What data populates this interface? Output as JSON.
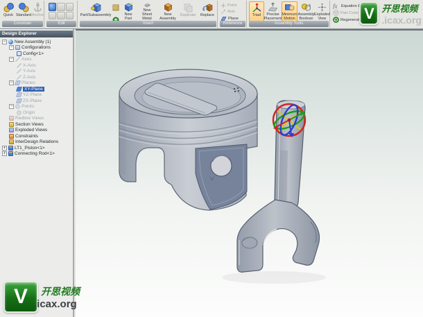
{
  "sidebar": {
    "title": "Design Explorer",
    "tree": [
      {
        "label": "New Assembly (1)",
        "level": 0,
        "state": "normal",
        "expanded": true
      },
      {
        "label": "Configurations",
        "level": 1,
        "state": "normal",
        "expanded": true
      },
      {
        "label": "Config<1>",
        "level": 2,
        "state": "normal"
      },
      {
        "label": "Axes",
        "level": 1,
        "state": "grayed",
        "expanded": true
      },
      {
        "label": "X-Axis",
        "level": 2,
        "state": "grayed"
      },
      {
        "label": "Y-Axis",
        "level": 2,
        "state": "grayed"
      },
      {
        "label": "Z-Axis",
        "level": 2,
        "state": "grayed"
      },
      {
        "label": "Planes",
        "level": 1,
        "state": "grayed",
        "expanded": true
      },
      {
        "label": "XY-Plane",
        "level": 2,
        "state": "selected"
      },
      {
        "label": "YZ-Plane",
        "level": 2,
        "state": "grayed"
      },
      {
        "label": "ZX-Plane",
        "level": 2,
        "state": "grayed"
      },
      {
        "label": "Points",
        "level": 1,
        "state": "grayed",
        "expanded": true
      },
      {
        "label": "Origin",
        "level": 2,
        "state": "grayed"
      },
      {
        "label": "Redline Views",
        "level": 1,
        "state": "grayed"
      },
      {
        "label": "Section Views",
        "level": 1,
        "state": "normal"
      },
      {
        "label": "Exploded Views",
        "level": 1,
        "state": "normal"
      },
      {
        "label": "Constraints",
        "level": 1,
        "state": "normal"
      },
      {
        "label": "InterDesign Relations",
        "level": 1,
        "state": "normal"
      },
      {
        "label": "LT1_Piston<1>",
        "level": 1,
        "state": "normal",
        "expanded": false
      },
      {
        "label": "Connecting Rod<1>",
        "level": 1,
        "state": "normal",
        "expanded": false
      }
    ]
  },
  "toolbar": {
    "groups": [
      {
        "label": "Constrain"
      },
      {
        "label": "Edit"
      },
      {
        "label": "Insert"
      },
      {
        "label": "Reference"
      },
      {
        "label": "Assembly Tools"
      }
    ],
    "buttons": {
      "quick": {
        "label": "Quick"
      },
      "standard": {
        "label": "Standard"
      },
      "anchor": {
        "label": "Anchor",
        "disabled": true
      },
      "part_subassembly": {
        "label": "Part/Subassembly"
      },
      "new_part": {
        "label": "New\nPart"
      },
      "new_sheet_metal": {
        "label": "New Sheet\nMetal"
      },
      "new_assembly": {
        "label": "New\nAssembly"
      },
      "duplicate": {
        "label": "Duplicate",
        "disabled": true
      },
      "replace": {
        "label": "Replace"
      },
      "point": {
        "label": "Point",
        "disabled": true
      },
      "axis": {
        "label": "Axis",
        "disabled": true
      },
      "plane": {
        "label": "Plane"
      },
      "triad": {
        "label": "Triad",
        "active": true
      },
      "precise_placement": {
        "label": "Precise\nPlacement"
      },
      "minimum_motion": {
        "label": "Minimum\nMotion",
        "active": true
      },
      "assembly_boolean": {
        "label": "Assembly\nBoolean"
      },
      "exploded_view": {
        "label": "Exploded\nView"
      },
      "equation_edit": {
        "label": "Equation Edit..."
      },
      "part_color": {
        "label": "Part Color",
        "disabled": true
      },
      "regenerate": {
        "label": "Regenerate"
      }
    }
  },
  "watermark": {
    "logo_letter": "V",
    "brand": "开思视频",
    "site": ".icax.org"
  },
  "colors": {
    "selection": "#2f5fb0",
    "active_tool": "#e79e3c",
    "watermark_green": "#1f7a1f",
    "viewport_top": "#cbd8d4",
    "viewport_bottom": "#fcfdfc",
    "model_gray": "#b7bdc7",
    "model_slate": "#76839b",
    "triad_red": "#d42222",
    "triad_green": "#18a018",
    "triad_blue": "#2a3ed0",
    "triad_yellow": "#e2c41e"
  }
}
